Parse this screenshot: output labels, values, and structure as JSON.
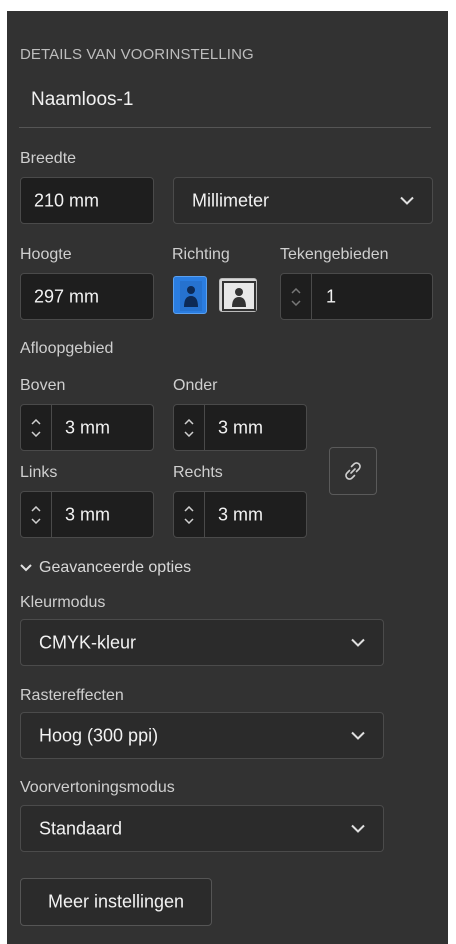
{
  "panel": {
    "section_title": "DETAILS VAN VOORINSTELLING",
    "preset_name": "Naamloos-1"
  },
  "size": {
    "width_label": "Breedte",
    "width_value": "210 mm",
    "unit_value": "Millimeter",
    "height_label": "Hoogte",
    "height_value": "297 mm",
    "orientation_label": "Richting",
    "orientation_selected": "portrait",
    "artboards_label": "Tekengebieden",
    "artboards_value": "1"
  },
  "bleed": {
    "label": "Afloopgebied",
    "top_label": "Boven",
    "top_value": "3 mm",
    "bottom_label": "Onder",
    "bottom_value": "3 mm",
    "left_label": "Links",
    "left_value": "3 mm",
    "right_label": "Rechts",
    "right_value": "3 mm",
    "link_icon": "chain-link-icon"
  },
  "advanced": {
    "toggle_label": "Geavanceerde opties",
    "color_mode_label": "Kleurmodus",
    "color_mode_value": "CMYK-kleur",
    "raster_label": "Rastereffecten",
    "raster_value": "Hoog (300 ppi)",
    "preview_label": "Voorvertoningsmodus",
    "preview_value": "Standaard"
  },
  "buttons": {
    "more_settings": "Meer instellingen"
  },
  "colors": {
    "panel_bg": "#323232",
    "field_bg": "#1e1e1e",
    "accent_blue": "#2a7de1"
  }
}
